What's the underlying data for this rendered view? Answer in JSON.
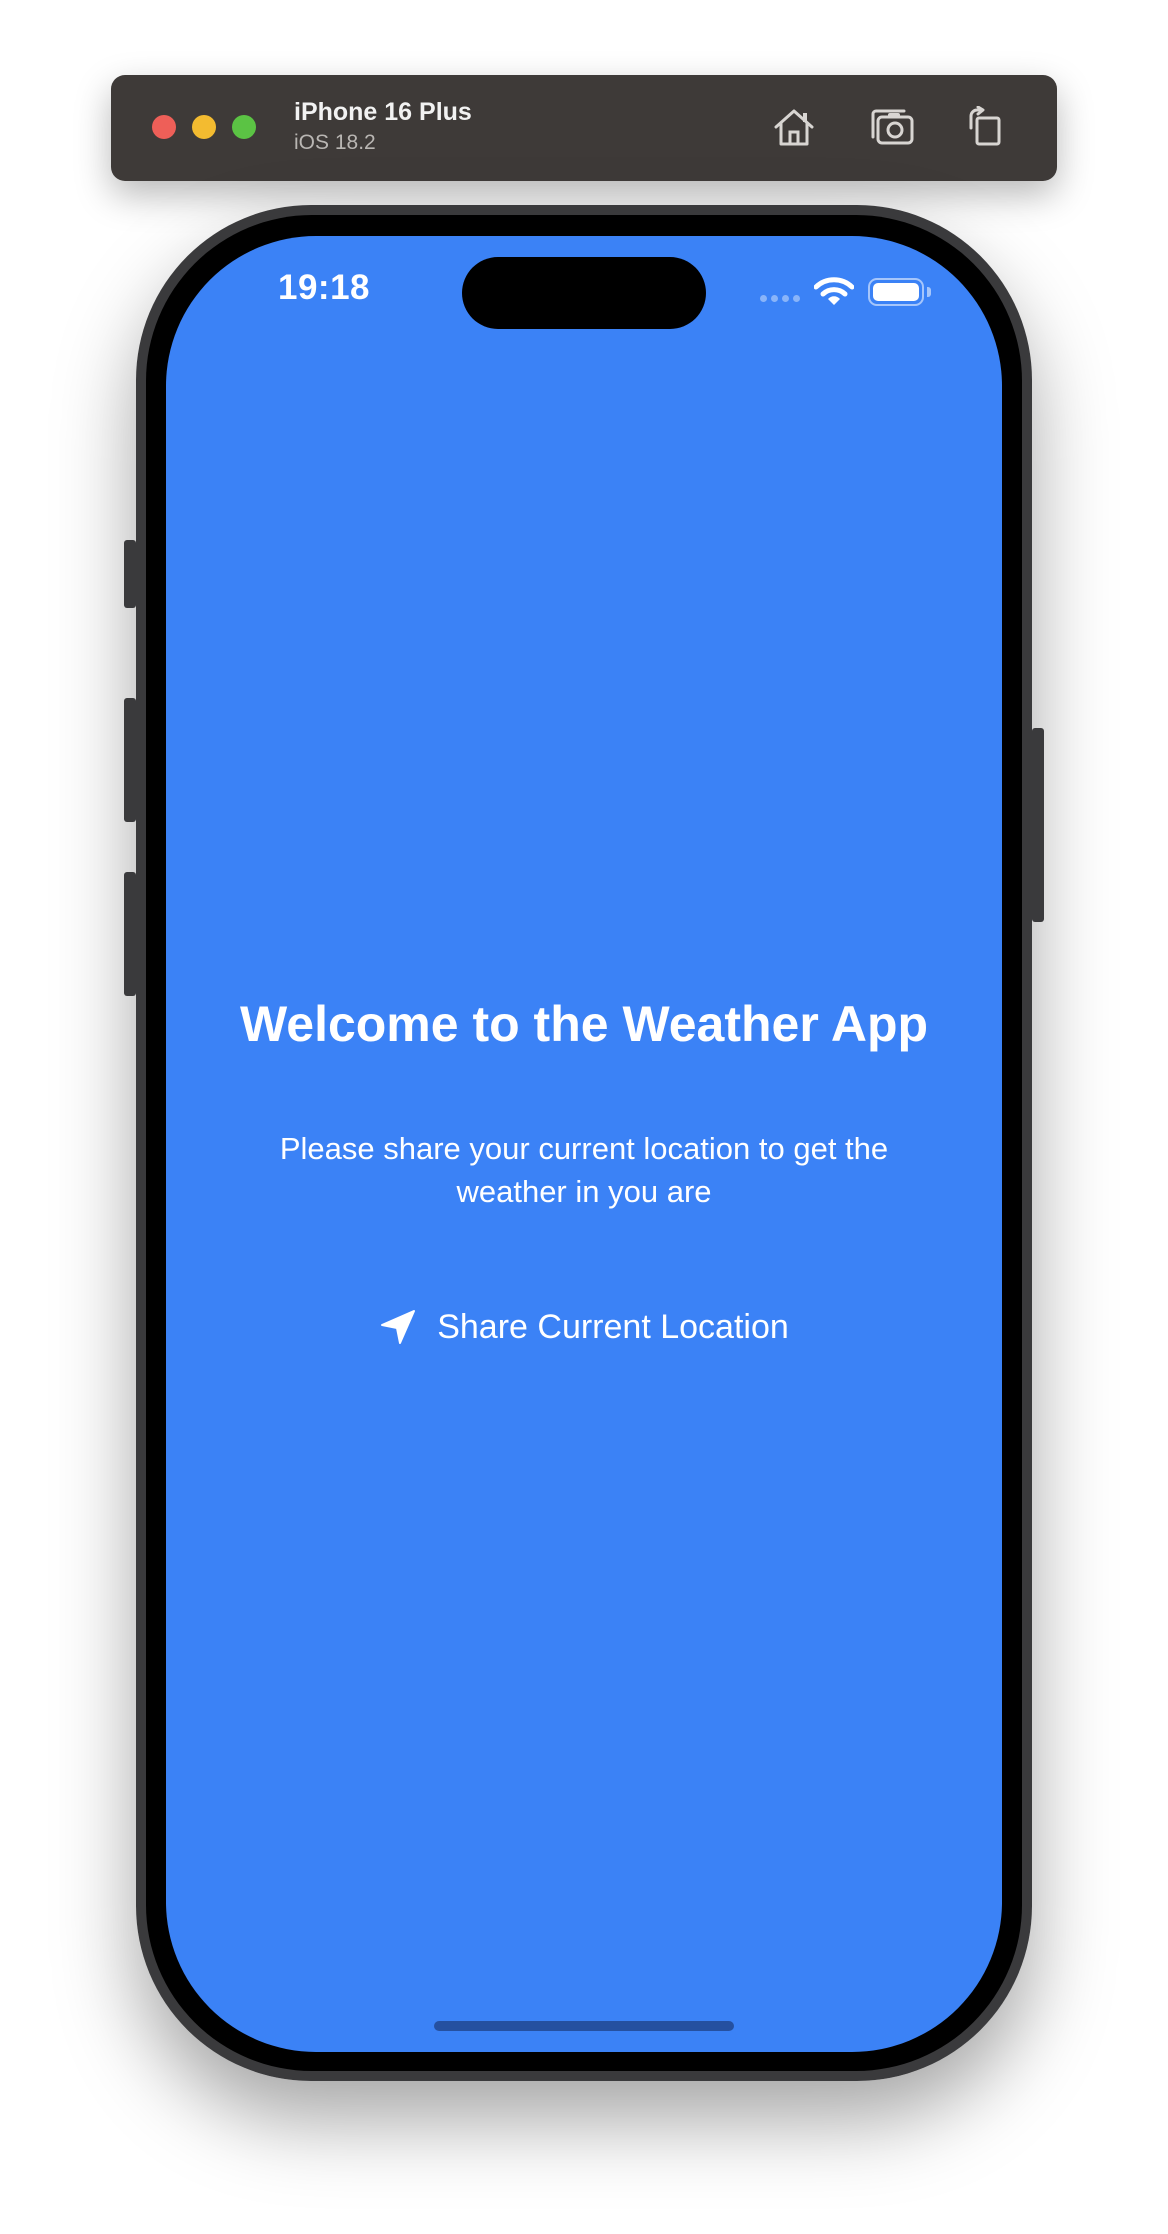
{
  "simulator": {
    "device_name": "iPhone 16 Plus",
    "os_version": "iOS 18.2",
    "toolbar": {
      "home_icon": "home-icon",
      "screenshot_icon": "camera-icon",
      "rotate_icon": "rotate-icon"
    }
  },
  "status_bar": {
    "time": "19:18",
    "icons": [
      "cellular-icon",
      "wifi-icon",
      "battery-icon"
    ]
  },
  "app": {
    "title": "Welcome to the Weather App",
    "subtitle": "Please share your current location to get the weather in you are",
    "share_button": {
      "label": "Share Current Location",
      "icon": "location-arrow-icon"
    }
  },
  "colors": {
    "screen_background": "#3b82f6",
    "text": "#ffffff",
    "simulator_bar": "#3e3a38"
  }
}
